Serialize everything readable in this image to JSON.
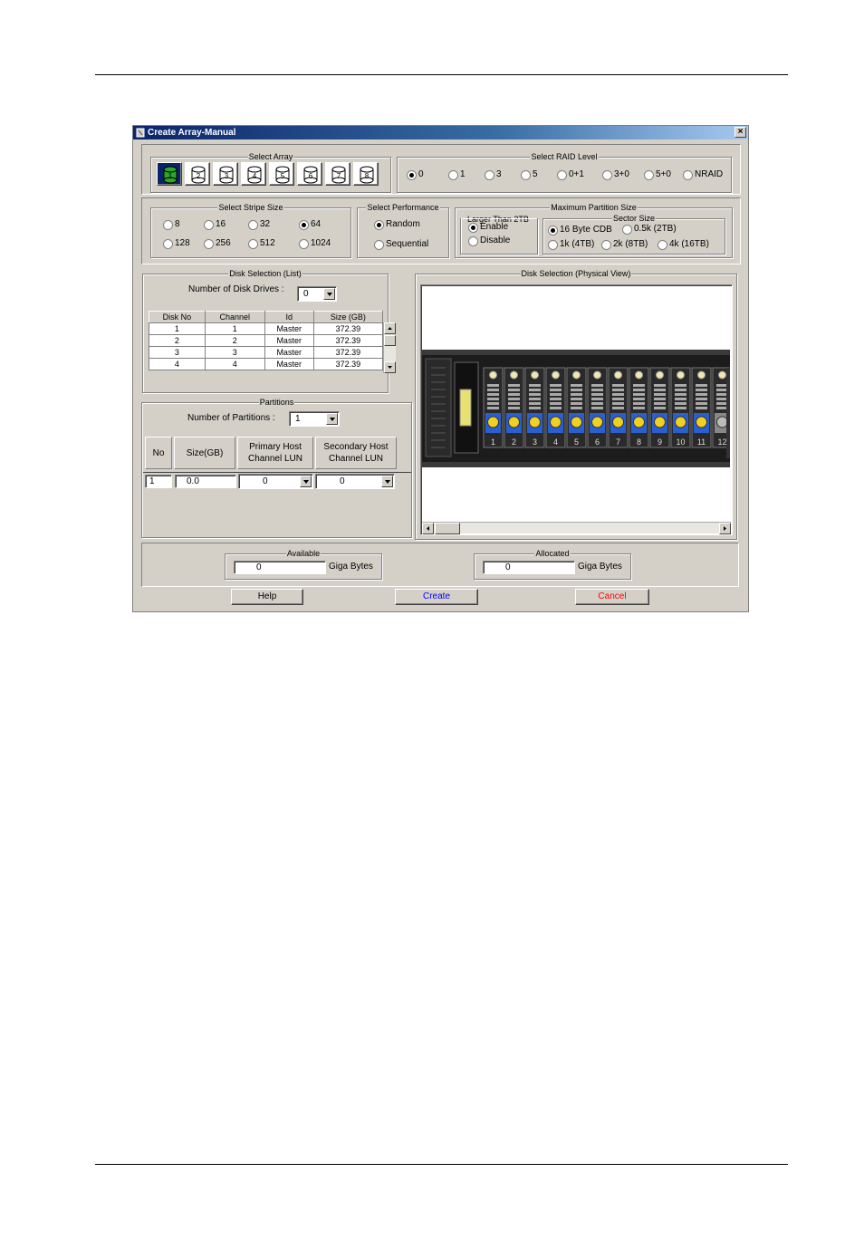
{
  "window": {
    "title": "Create Array-Manual",
    "close": "×"
  },
  "select_array": {
    "legend": "Select Array",
    "buttons": [
      "1",
      "2",
      "3",
      "4",
      "5",
      "6",
      "7",
      "8"
    ],
    "selected": "1"
  },
  "raid": {
    "legend": "Select RAID Level",
    "options": [
      "0",
      "1",
      "3",
      "5",
      "0+1",
      "3+0",
      "5+0",
      "NRAID"
    ],
    "selected": "0"
  },
  "stripe": {
    "legend": "Select Stripe Size",
    "options": [
      "8",
      "16",
      "32",
      "64",
      "128",
      "256",
      "512",
      "1024"
    ],
    "selected": "64"
  },
  "performance": {
    "legend": "Select Performance",
    "options": [
      "Random",
      "Sequential"
    ],
    "selected": "Random"
  },
  "partition_size": {
    "legend": "Maximum Partition Size",
    "larger": {
      "legend": "Larger Than 2TB",
      "options": [
        "Enable",
        "Disable"
      ],
      "selected": "Enable"
    },
    "sector": {
      "legend": "Sector Size",
      "options": [
        "16 Byte CDB",
        "0.5k (2TB)",
        "1k (4TB)",
        "2k (8TB)",
        "4k (16TB)"
      ],
      "selected": "16 Byte CDB"
    }
  },
  "disk_list": {
    "legend": "Disk Selection (List)",
    "count_label": "Number of Disk Drives :",
    "count_value": "0",
    "columns": [
      "Disk No",
      "Channel",
      "Id",
      "Size (GB)"
    ],
    "rows": [
      [
        "1",
        "1",
        "Master",
        "372.39"
      ],
      [
        "2",
        "2",
        "Master",
        "372.39"
      ],
      [
        "3",
        "3",
        "Master",
        "372.39"
      ],
      [
        "4",
        "4",
        "Master",
        "372.39"
      ]
    ]
  },
  "physical": {
    "legend": "Disk Selection (Physical View)",
    "bays": [
      "1",
      "2",
      "3",
      "4",
      "5",
      "6",
      "7",
      "8",
      "9",
      "10",
      "11",
      "12"
    ]
  },
  "partitions": {
    "legend": "Partitions",
    "count_label": "Number of Partitions :",
    "count_value": "1",
    "columns": [
      "No",
      "Size(GB)",
      "Primary Host Channel LUN",
      "Secondary Host Channel LUN"
    ],
    "row": {
      "no": "1",
      "size": "0.0",
      "primary": "0",
      "secondary": "0"
    }
  },
  "available": {
    "legend": "Available",
    "value": "0",
    "unit": "Giga Bytes"
  },
  "allocated": {
    "legend": "Allocated",
    "value": "0",
    "unit": "Giga Bytes"
  },
  "buttons": {
    "help": "Help",
    "create": "Create",
    "cancel": "Cancel"
  },
  "colors": {
    "create": "#0000ff",
    "cancel": "#ff0000",
    "title": "#0a246a"
  }
}
